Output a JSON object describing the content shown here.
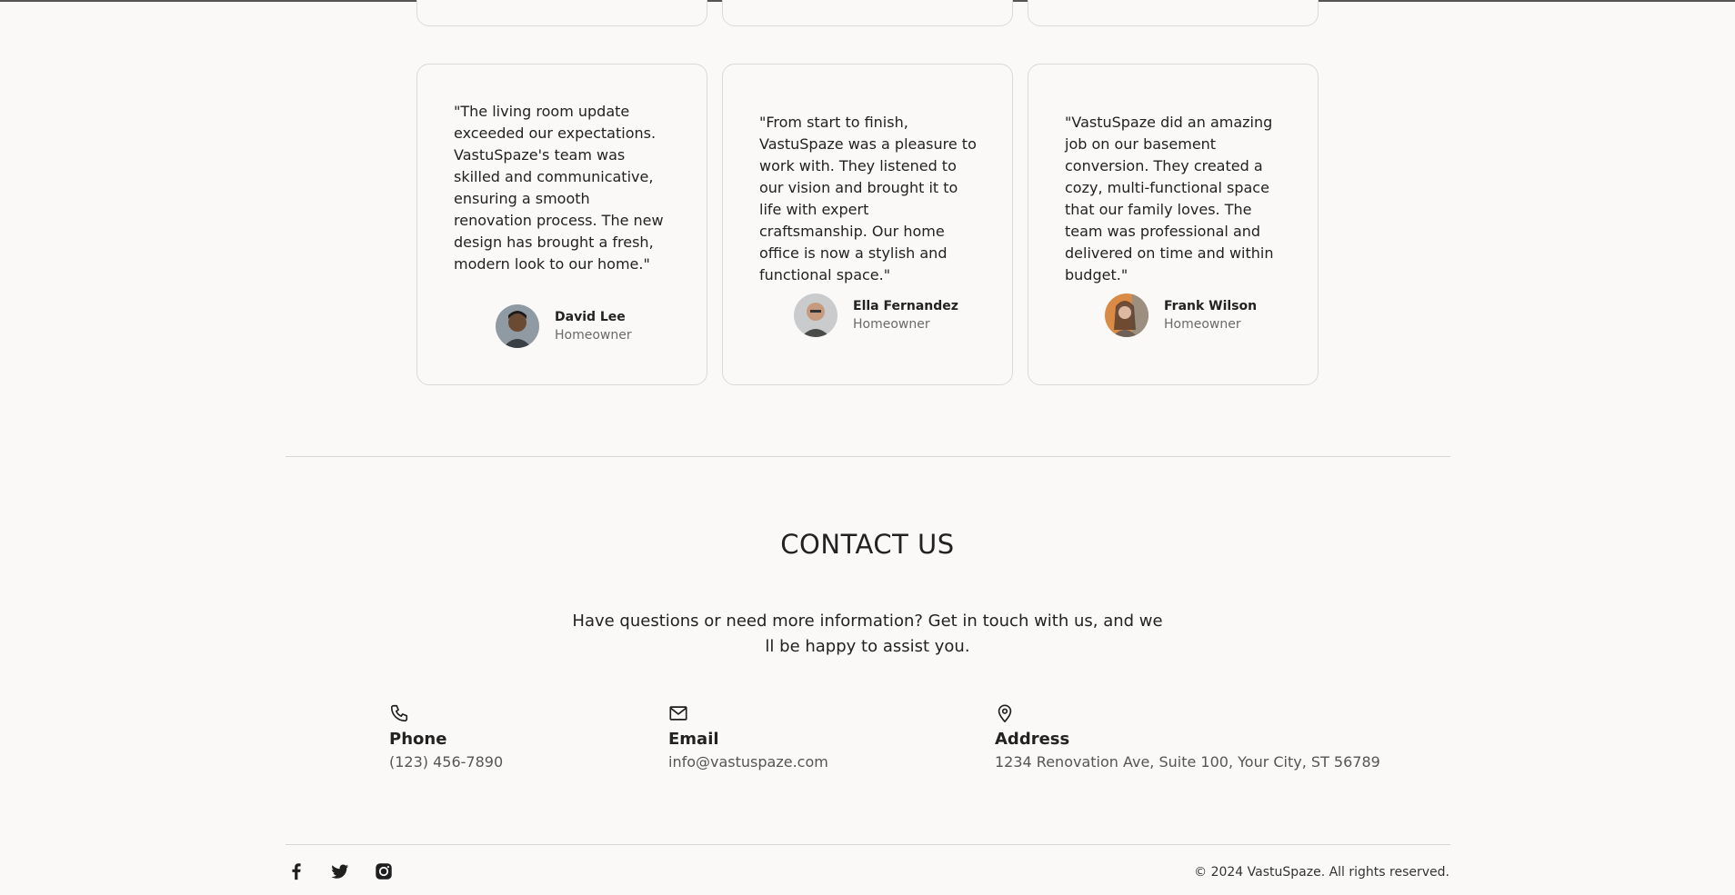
{
  "testimonials": [
    {
      "quote": "\"The living room update exceeded our expectations. VastuSpaze's team was skilled and communicative, ensuring a smooth renovation process. The new design has brought a fresh, modern look to our home.\"",
      "name": "David Lee",
      "role": "Homeowner"
    },
    {
      "quote": "\"From start to finish, VastuSpaze was a pleasure to work with. They listened to our vision and brought it to life with expert craftsmanship. Our home office is now a stylish and functional space.\"",
      "name": "Ella Fernandez",
      "role": "Homeowner"
    },
    {
      "quote": "\"VastuSpaze did an amazing job on our basement conversion. They created a cozy, multi-functional space that our family loves. The team was professional and delivered on time and within budget.\"",
      "name": "Frank Wilson",
      "role": "Homeowner"
    }
  ],
  "contact": {
    "title": "CONTACT US",
    "subtitle": "Have questions or need more information? Get in touch with us, and we ll be happy to assist you.",
    "phone": {
      "icon": "phone-icon",
      "label": "Phone",
      "value": "(123) 456-7890"
    },
    "email": {
      "icon": "mail-icon",
      "label": "Email",
      "value": "info@vastuspaze.com"
    },
    "address": {
      "icon": "map-pin-icon",
      "label": "Address",
      "value": "1234 Renovation Ave, Suite 100, Your City, ST 56789"
    }
  },
  "footer": {
    "social": [
      "facebook-icon",
      "twitter-icon",
      "instagram-icon"
    ],
    "copyright": "© 2024 VastuSpaze. All rights reserved."
  }
}
